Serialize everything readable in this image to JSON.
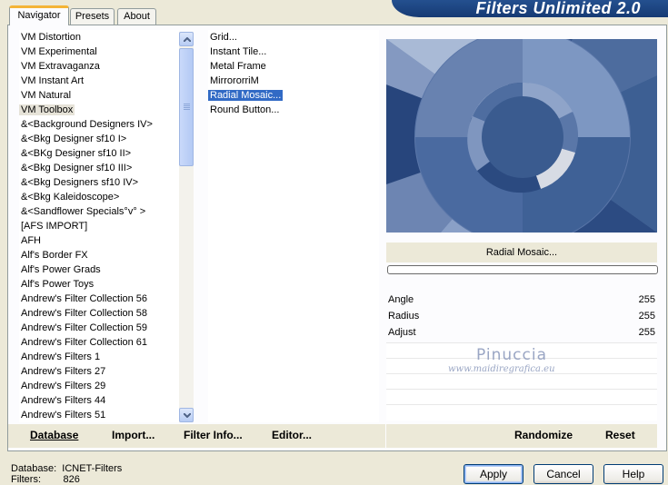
{
  "tabs": [
    {
      "label": "Navigator",
      "active": true
    },
    {
      "label": "Presets",
      "active": false
    },
    {
      "label": "About",
      "active": false
    }
  ],
  "banner": {
    "title": "Filters Unlimited 2.0"
  },
  "categories": [
    "VM Distortion",
    "VM Experimental",
    "VM Extravaganza",
    "VM Instant Art",
    "VM Natural",
    "VM Toolbox",
    "&<Background Designers IV>",
    "&<Bkg Designer sf10 I>",
    "&<BKg Designer sf10 II>",
    "&<Bkg Designer sf10 III>",
    "&<Bkg Designers sf10 IV>",
    "&<Bkg Kaleidoscope>",
    "&<Sandflower Specials°v° >",
    "[AFS IMPORT]",
    "AFH",
    "Alf's Border FX",
    "Alf's Power Grads",
    "Alf's Power Toys",
    "Andrew's Filter Collection 56",
    "Andrew's Filter Collection 58",
    "Andrew's Filter Collection 59",
    "Andrew's Filter Collection 61",
    "Andrew's Filters 1",
    "Andrew's Filters 27",
    "Andrew's Filters 29",
    "Andrew's Filters 44",
    "Andrew's Filters 51"
  ],
  "selected_category": "VM Toolbox",
  "filters": [
    "Grid...",
    "Instant Tile...",
    "Metal Frame",
    "MirrororriM",
    "Radial Mosaic...",
    "Round Button..."
  ],
  "selected_filter": "Radial Mosaic...",
  "current_filter_label": "Radial Mosaic...",
  "params": [
    {
      "name": "Angle",
      "value": "255"
    },
    {
      "name": "Radius",
      "value": "255"
    },
    {
      "name": "Adjust",
      "value": "255"
    }
  ],
  "watermark": {
    "line1": "Pinuccia",
    "line2": "www.maidiregrafica.eu"
  },
  "bottom_buttons": {
    "database": "Database",
    "import": "Import...",
    "filter_info": "Filter Info...",
    "editor": "Editor...",
    "randomize": "Randomize",
    "reset": "Reset"
  },
  "status": {
    "database_label": "Database:",
    "database_value": "ICNET-Filters",
    "filters_label": "Filters:",
    "filters_value": "826"
  },
  "dialog_buttons": {
    "apply": "Apply",
    "cancel": "Cancel",
    "help": "Help"
  },
  "colors": {
    "selection": "#316ac5",
    "banner": "#1c4585",
    "preview_base": "#3d5f93"
  }
}
